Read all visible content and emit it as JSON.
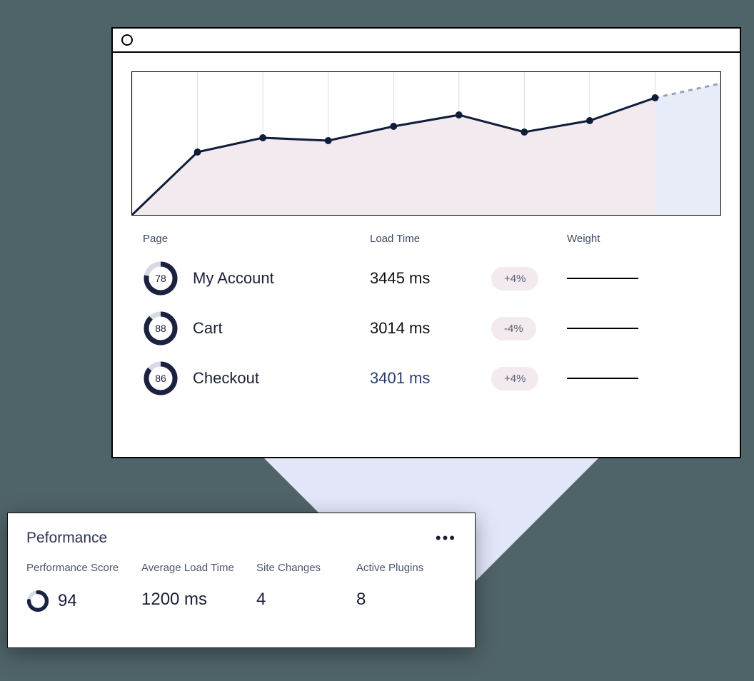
{
  "chart_data": {
    "type": "line",
    "x": [
      0,
      1,
      2,
      3,
      4,
      5,
      6,
      7,
      8,
      9
    ],
    "values": [
      0,
      44,
      54,
      52,
      62,
      70,
      58,
      66,
      82,
      92
    ],
    "projected_last_segment": true,
    "grid_vertical": 10,
    "ylim": [
      0,
      100
    ],
    "fill_color_solid": "#f2eaef",
    "fill_color_projected": "#e8ecf9",
    "line_color": "#0f1d3a"
  },
  "table": {
    "headers": {
      "page": "Page",
      "load": "Load Time",
      "weight": "Weight"
    },
    "rows": [
      {
        "score": 78,
        "page": "My Account",
        "load": "3445 ms",
        "delta": "+4%",
        "load_color": "#111"
      },
      {
        "score": 88,
        "page": "Cart",
        "load": "3014 ms",
        "delta": "-4%",
        "load_color": "#111"
      },
      {
        "score": 86,
        "page": "Checkout",
        "load": "3401 ms",
        "delta": "+4%",
        "load_color": "#2b3d6b"
      }
    ]
  },
  "perf": {
    "title": "Peformance",
    "metrics": {
      "score_label": "Performance Score",
      "score_value": "94",
      "avg_label": "Average Load Time",
      "avg_value": "1200 ms",
      "changes_label": "Site Changes",
      "changes_value": "4",
      "plugins_label": "Active Plugins",
      "plugins_value": "8"
    }
  }
}
